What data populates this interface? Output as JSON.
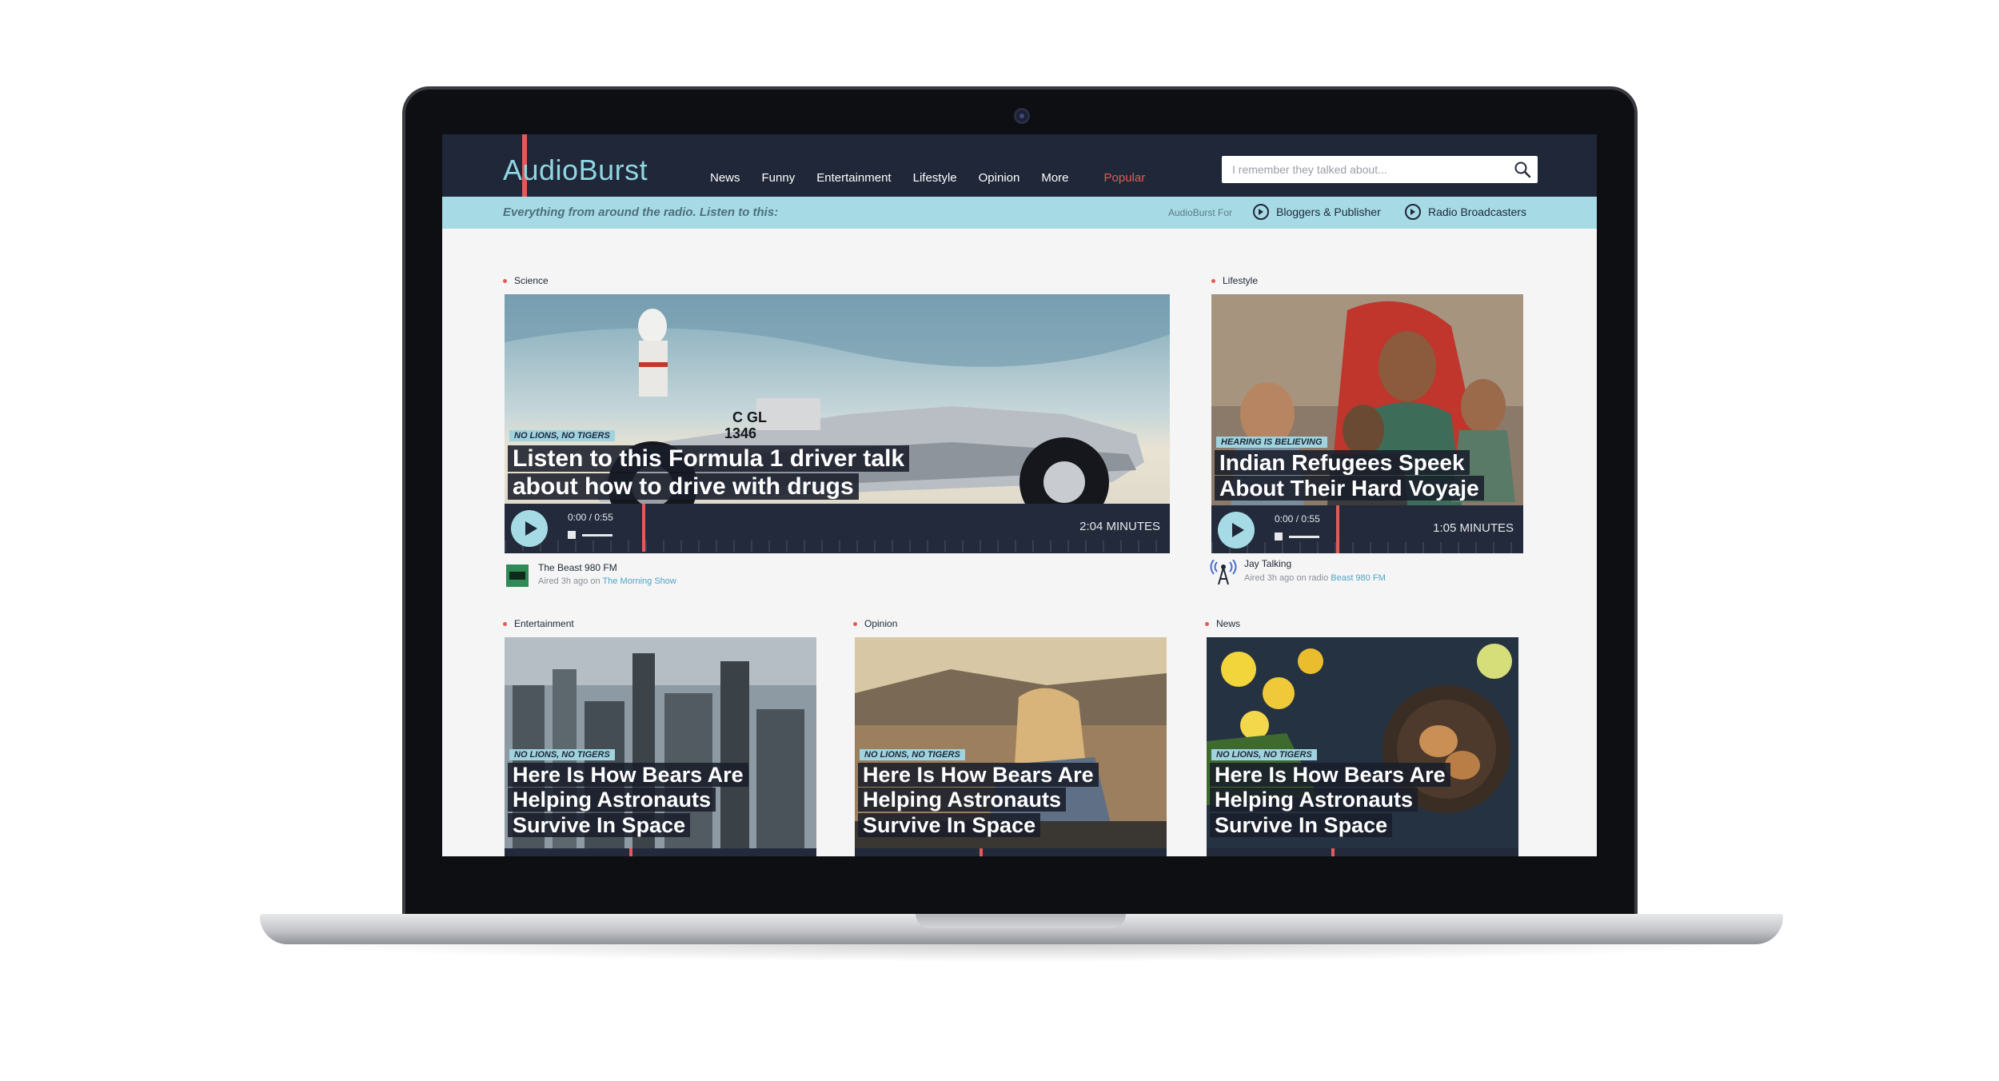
{
  "brand": {
    "name": "AudioBurst"
  },
  "nav": {
    "items": [
      "News",
      "Funny",
      "Entertainment",
      "Lifestyle",
      "Opinion",
      "More",
      "Popular"
    ],
    "active": "Popular"
  },
  "search": {
    "placeholder": "I remember they talked about..."
  },
  "subbar": {
    "tagline": "Everything from around the radio. Listen to this:",
    "for_label": "AudioBurst For",
    "links": [
      "Bloggers & Publisher",
      "Radio Broadcasters"
    ]
  },
  "featured": [
    {
      "category": "Science",
      "tag": "NO LIONS, NO TIGERS",
      "headline_lines": [
        "Listen to this Formula 1 driver talk",
        "about how to drive with drugs"
      ],
      "time_current": "0:00",
      "time_total": "0:55",
      "time_sep": "/",
      "duration": "2:04 MINUTES",
      "source_name": "The Beast 980 FM",
      "aired_prefix": "Aired 3h ago on",
      "aired_link": "The Morning Show"
    },
    {
      "category": "Lifestyle",
      "tag": "HEARING IS BELIEVING",
      "headline_lines": [
        "Indian Refugees Speek",
        "About Their Hard Voyaje"
      ],
      "time_current": "0:00",
      "time_total": "0:55",
      "time_sep": "/",
      "duration": "1:05 MINUTES",
      "source_name": "Jay Talking",
      "aired_prefix": "Aired 3h ago on radio",
      "aired_link": "Beast 980 FM"
    }
  ],
  "grid": [
    {
      "category": "Entertainment",
      "tag": "NO LIONS, NO TIGERS",
      "headline_lines": [
        "Here Is How Bears Are",
        "Helping Astronauts",
        "Survive In Space"
      ]
    },
    {
      "category": "Opinion",
      "tag": "NO LIONS, NO TIGERS",
      "headline_lines": [
        "Here Is How Bears Are",
        "Helping Astronauts",
        "Survive In Space"
      ]
    },
    {
      "category": "News",
      "tag": "NO LIONS, NO TIGERS",
      "headline_lines": [
        "Here Is How Bears Are",
        "Helping Astronauts",
        "Survive In Space"
      ]
    }
  ],
  "colors": {
    "navy": "#1f2738",
    "accent_red": "#e35b57",
    "light_blue": "#a6dbe5",
    "logo_blue": "#8fd6e3"
  },
  "icons": [
    "search-icon",
    "play-icon",
    "stop-icon",
    "arrow-circle-icon",
    "station-logo-icon",
    "radio-tower-icon"
  ]
}
